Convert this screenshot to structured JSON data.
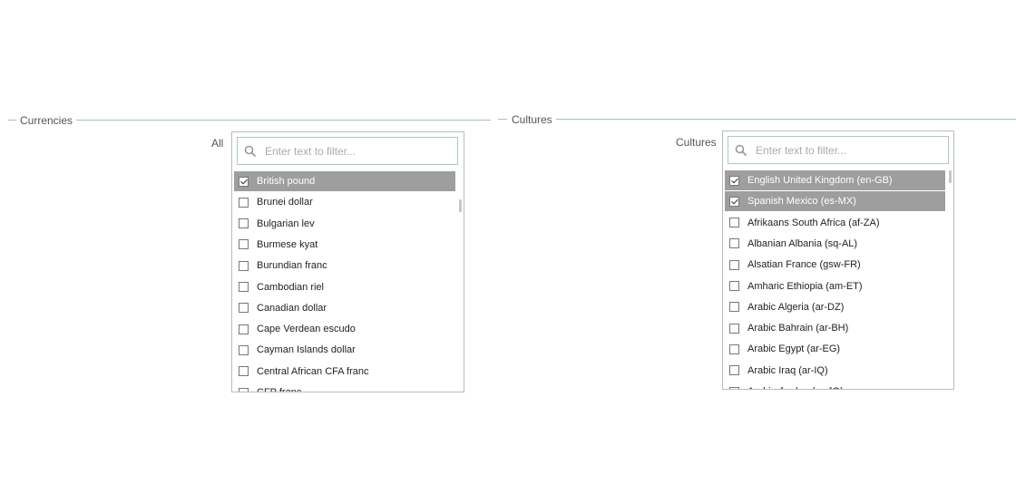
{
  "currencies_section": {
    "title": "Currencies",
    "field_label": "All",
    "filter_placeholder": "Enter text to filter...",
    "items": [
      {
        "label": "British pound",
        "checked": true
      },
      {
        "label": "Brunei dollar",
        "checked": false
      },
      {
        "label": "Bulgarian lev",
        "checked": false
      },
      {
        "label": "Burmese kyat",
        "checked": false
      },
      {
        "label": "Burundian franc",
        "checked": false
      },
      {
        "label": "Cambodian riel",
        "checked": false
      },
      {
        "label": "Canadian dollar",
        "checked": false
      },
      {
        "label": "Cape Verdean escudo",
        "checked": false
      },
      {
        "label": "Cayman Islands dollar",
        "checked": false
      },
      {
        "label": "Central African CFA franc",
        "checked": false
      },
      {
        "label": "CFP franc",
        "checked": false
      }
    ]
  },
  "cultures_section": {
    "title": "Cultures",
    "field_label": "Cultures",
    "filter_placeholder": "Enter text to filter...",
    "items": [
      {
        "label": "English United Kingdom (en-GB)",
        "checked": true
      },
      {
        "label": "Spanish Mexico (es-MX)",
        "checked": true
      },
      {
        "label": "Afrikaans South Africa (af-ZA)",
        "checked": false
      },
      {
        "label": "Albanian Albania (sq-AL)",
        "checked": false
      },
      {
        "label": "Alsatian France (gsw-FR)",
        "checked": false
      },
      {
        "label": "Amharic Ethiopia (am-ET)",
        "checked": false
      },
      {
        "label": "Arabic Algeria (ar-DZ)",
        "checked": false
      },
      {
        "label": "Arabic Bahrain (ar-BH)",
        "checked": false
      },
      {
        "label": "Arabic Egypt (ar-EG)",
        "checked": false
      },
      {
        "label": "Arabic Iraq (ar-IQ)",
        "checked": false
      },
      {
        "label": "Arabic Jordan (ar-JO)",
        "checked": false
      }
    ]
  },
  "colors": {
    "selected_bg": "#9e9e9e",
    "section_line": "#9dc3c3"
  },
  "icons": {
    "filter": "search-icon"
  }
}
